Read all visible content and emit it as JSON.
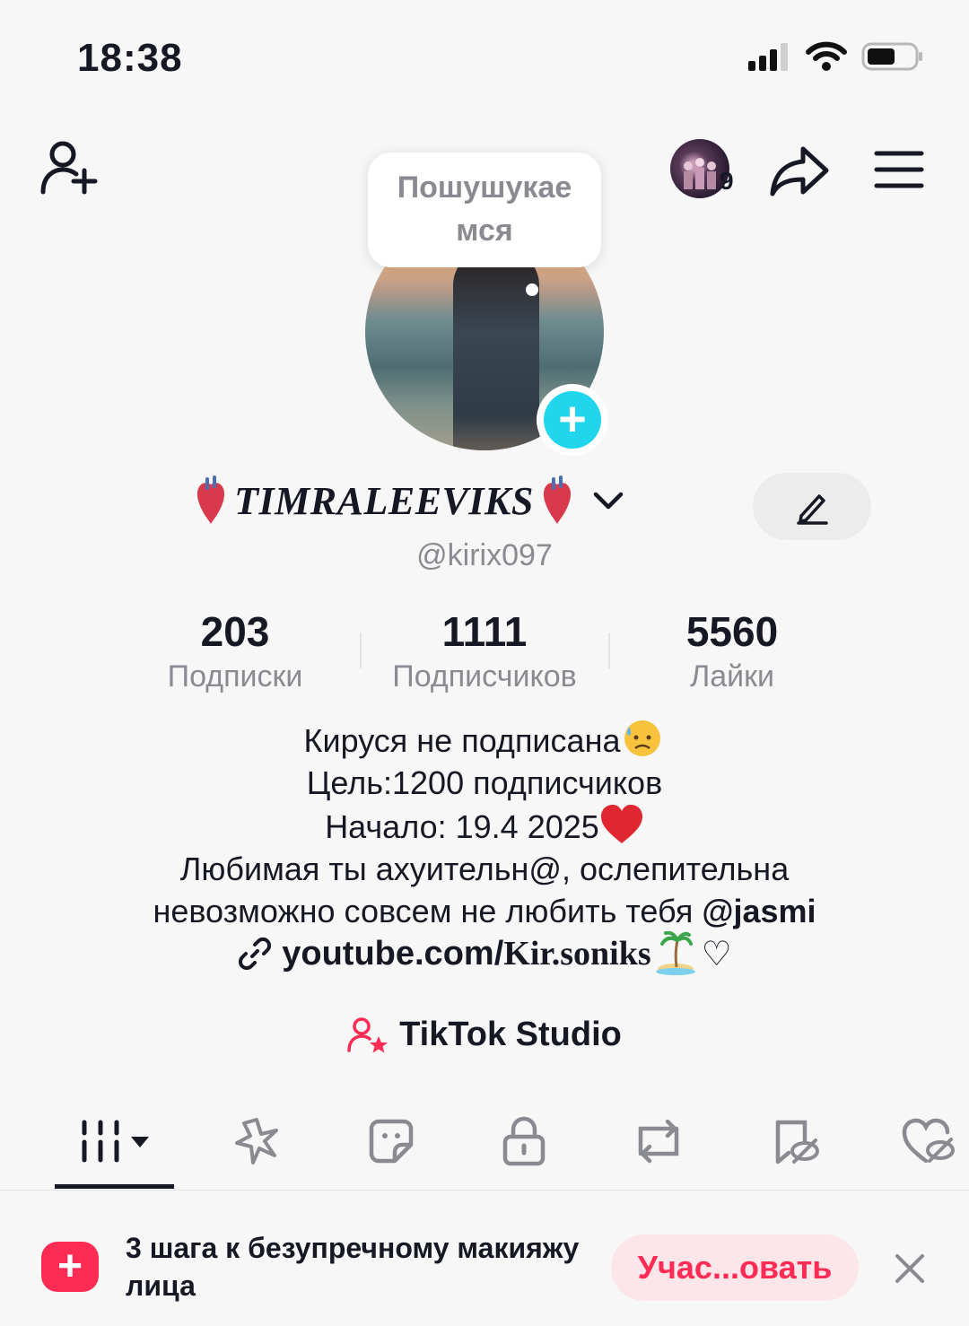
{
  "status_bar": {
    "time": "18:38"
  },
  "header": {
    "story_count": "9",
    "bubble_text": "Пошушукае мся"
  },
  "profile": {
    "display_name": "TIMRALEEVIKS",
    "handle": "@kirix097"
  },
  "stats": [
    {
      "value": "203",
      "label": "Подписки"
    },
    {
      "value": "1111",
      "label": "Подписчиков"
    },
    {
      "value": "5560",
      "label": "Лайки"
    }
  ],
  "bio": {
    "line1": "Кируся не подписана",
    "line2": "Цель:1200 подписчиков",
    "line3": "Начало: 19.4 2025",
    "line4": "Любимая ты ахуительн@, ослепительна",
    "line5_text": "невозможно совсем не любить тебя ",
    "line5_mention": "@jasmi",
    "link_prefix": "youtube.com/",
    "link_suffix": "Kir.soniks",
    "link_tail": "♡"
  },
  "studio": {
    "label": "TikTok Studio"
  },
  "tabs": [
    {
      "icon": "grid-icon"
    },
    {
      "icon": "sparkle-icon"
    },
    {
      "icon": "sticker-icon"
    },
    {
      "icon": "lock-icon"
    },
    {
      "icon": "repost-icon"
    },
    {
      "icon": "hidden-bookmark-icon"
    },
    {
      "icon": "hidden-heart-icon"
    }
  ],
  "banner": {
    "text": "3 шага к безупречному макияжу лица",
    "button": "Учас...овать"
  },
  "colors": {
    "accent": "#fe2c55",
    "cyan": "#20d5ec",
    "text": "#161823",
    "muted": "#8a8b91"
  }
}
